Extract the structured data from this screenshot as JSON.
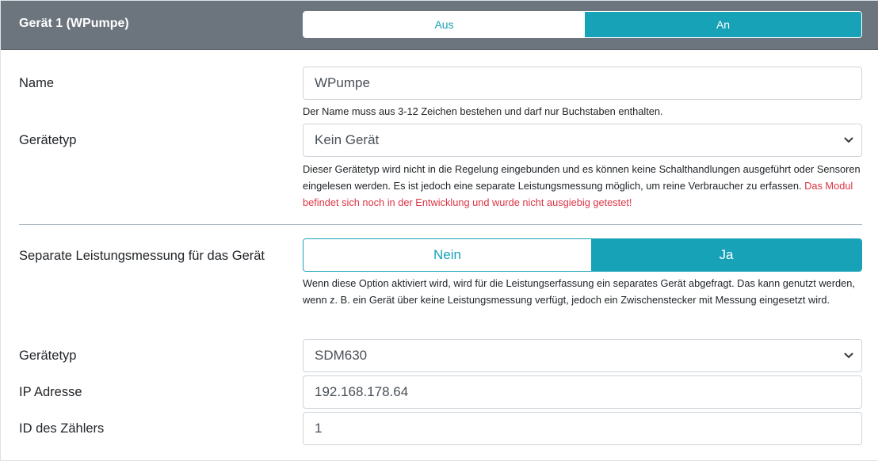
{
  "header": {
    "title": "Gerät 1 (WPumpe)",
    "toggle_off": "Aus",
    "toggle_on": "An"
  },
  "name_row": {
    "label": "Name",
    "value": "WPumpe",
    "help": "Der Name muss aus 3-12 Zeichen bestehen und darf nur Buchstaben enthalten."
  },
  "device_type_row": {
    "label": "Gerätetyp",
    "selected": "Kein Gerät",
    "help": "Dieser Gerätetyp wird nicht in die Regelung eingebunden und es können keine Schalthandlungen ausgeführt oder Sensoren eingelesen werden. Es ist jedoch eine separate Leistungsmessung möglich, um reine Verbraucher zu erfassen.",
    "warning": "Das Modul befindet sich noch in der Entwicklung und wurde nicht ausgiebig getestet!"
  },
  "separate_measurement_row": {
    "label": "Separate Leistungsmessung für das Gerät",
    "option_no": "Nein",
    "option_yes": "Ja",
    "help": "Wenn diese Option aktiviert wird, wird für die Leistungserfassung ein separates Gerät abgefragt. Das kann genutzt werden, wenn z. B. ein Gerät über keine Leistungsmessung verfügt, jedoch ein Zwischenstecker mit Messung eingesetzt wird."
  },
  "meter_type_row": {
    "label": "Gerätetyp",
    "selected": "SDM630"
  },
  "ip_row": {
    "label": "IP Adresse",
    "value": "192.168.178.64"
  },
  "meter_id_row": {
    "label": "ID des Zählers",
    "value": "1"
  },
  "colors": {
    "header_bg": "#6c757d",
    "accent": "#17a2b8",
    "warning": "#dc3545"
  }
}
